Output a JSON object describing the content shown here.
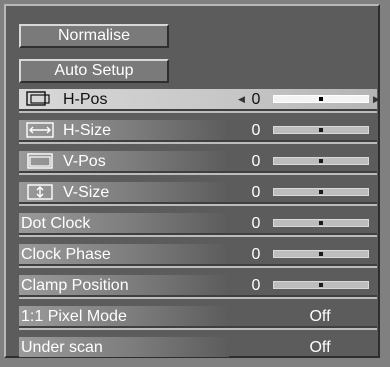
{
  "buttons": {
    "normalise": "Normalise",
    "auto_setup": "Auto Setup"
  },
  "rows": [
    {
      "id": "h-pos",
      "label": "H-Pos",
      "value": "0",
      "slider_position_fraction": 0.5,
      "selected": true
    },
    {
      "id": "h-size",
      "label": "H-Size",
      "value": "0",
      "slider_position_fraction": 0.5,
      "selected": false
    },
    {
      "id": "v-pos",
      "label": "V-Pos",
      "value": "0",
      "slider_position_fraction": 0.5,
      "selected": false
    },
    {
      "id": "v-size",
      "label": "V-Size",
      "value": "0",
      "slider_position_fraction": 0.5,
      "selected": false
    },
    {
      "id": "dot-clock",
      "label": "Dot Clock",
      "value": "0",
      "slider_position_fraction": 0.5,
      "selected": false
    },
    {
      "id": "clock-phase",
      "label": "Clock Phase",
      "value": "0",
      "slider_position_fraction": 0.5,
      "selected": false
    },
    {
      "id": "clamp-position",
      "label": "Clamp Position",
      "value": "0",
      "slider_position_fraction": 0.5,
      "selected": false
    },
    {
      "id": "pixel-mode",
      "label": "1:1 Pixel Mode",
      "value": "Off"
    },
    {
      "id": "under-scan",
      "label": "Under scan",
      "value": "Off"
    }
  ],
  "icons": {
    "h-pos": "horizontal-position-icon",
    "h-size": "horizontal-size-icon",
    "v-pos": "vertical-position-icon",
    "v-size": "vertical-size-icon"
  },
  "colors": {
    "panel": "#5c5c5c",
    "highlight": "#d0d0d0",
    "text": "#ffffff"
  }
}
